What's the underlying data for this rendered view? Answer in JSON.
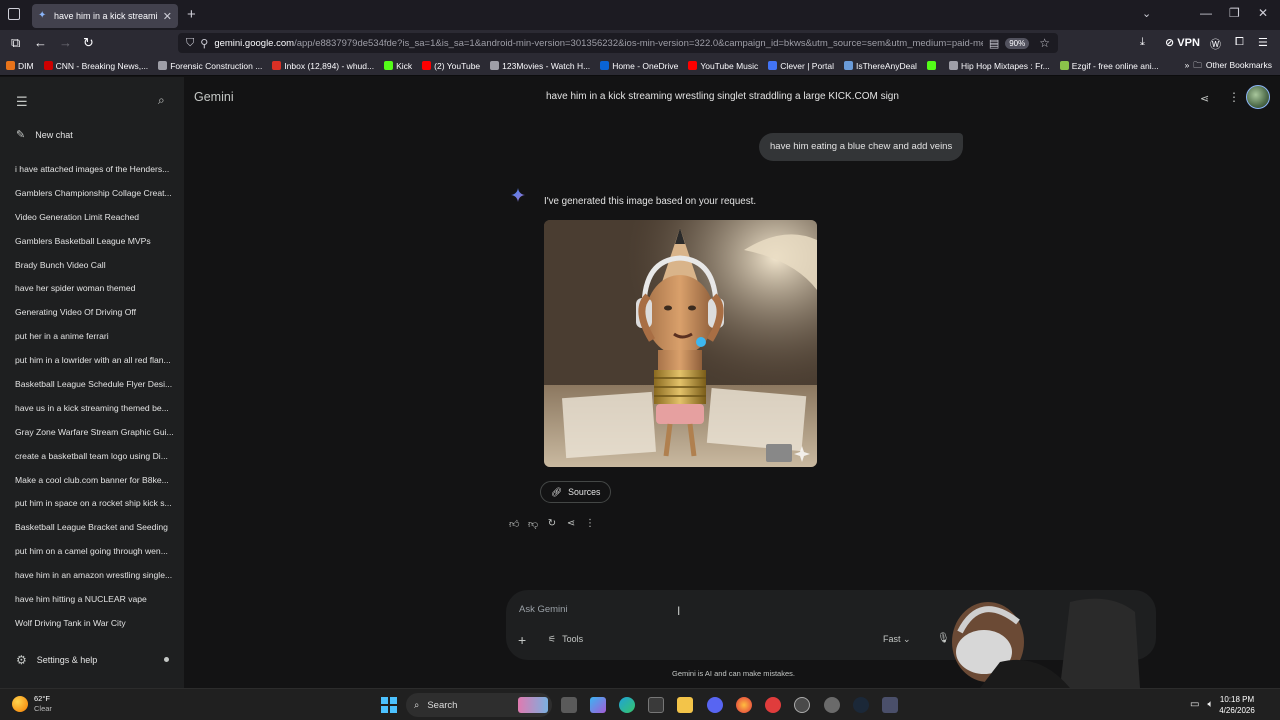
{
  "browser": {
    "tab_title": "have him in a kick streaming wr",
    "url_host": "gemini.google.com",
    "url_rest": "/app/e8837979de534fde?is_sa=1&is_sa=1&android-min-version=301356232&ios-min-version=322.0&campaign_id=bkws&utm_source=sem&utm_medium=paid-medi",
    "url_prefix": "",
    "zoom": "90%",
    "vpn_label": "VPN",
    "bookmarks": [
      {
        "label": "DIM",
        "color": "#e8731a"
      },
      {
        "label": "CNN - Breaking News,...",
        "color": "#cc0000"
      },
      {
        "label": "Forensic Construction ...",
        "color": "#9e9ea7"
      },
      {
        "label": "Inbox (12,894) - whud...",
        "color": "#d93025"
      },
      {
        "label": "Kick",
        "color": "#53fc18"
      },
      {
        "label": "(2) YouTube",
        "color": "#ff0000"
      },
      {
        "label": "123Movies - Watch H...",
        "color": "#9e9ea7"
      },
      {
        "label": "Home - OneDrive",
        "color": "#0a64d6"
      },
      {
        "label": "YouTube Music",
        "color": "#ff0000"
      },
      {
        "label": "Clever | Portal",
        "color": "#4274f6"
      },
      {
        "label": "IsThereAnyDeal",
        "color": "#6a9bd8"
      },
      {
        "label": "",
        "color": "#53fc18"
      },
      {
        "label": "Hip Hop Mixtapes : Fr...",
        "color": "#9e9ea7"
      },
      {
        "label": "Ezgif - free online ani...",
        "color": "#8bc34a"
      }
    ],
    "other_bookmarks": "Other Bookmarks"
  },
  "sidebar": {
    "new_chat": "New chat",
    "chats": [
      "i have attached images of the Henders...",
      "Gamblers Championship Collage Creat...",
      "Video Generation Limit Reached",
      "Gamblers Basketball League MVPs",
      "Brady Bunch Video Call",
      "have her spider woman themed",
      "Generating Video Of Driving Off",
      "put her in a anime ferrari",
      "put him in a lowrider with an all red flan...",
      "Basketball League Schedule Flyer Desi...",
      "have us in a kick streaming themed be...",
      "Gray Zone Warfare Stream Graphic Gui...",
      "create a basketball team logo using Di...",
      "Make a cool club.com banner for B8ke...",
      "put him in space on a rocket ship kick s...",
      "Basketball League Bracket and Seeding",
      "put him on a camel going through wen...",
      "have him in an amazon wrestling single...",
      "have him hitting a NUCLEAR vape",
      "Wolf Driving Tank in War City"
    ],
    "settings": "Settings & help"
  },
  "main": {
    "brand": "Gemini",
    "conversation_title": "have him in a kick streaming wrestling singlet straddling a large KICK.COM sign",
    "user_message": "have him eating a blue chew and add veins",
    "reply_text": "I've generated this image based on your request.",
    "sources": "Sources",
    "input_placeholder": "Ask Gemini",
    "tools": "Tools",
    "mode": "Fast",
    "disclaimer": "Gemini is AI and can make mistakes."
  },
  "taskbar": {
    "temp": "62°F",
    "condition": "Clear",
    "search": "Search",
    "time": "10:18 PM",
    "date": "4/26/2026"
  },
  "colors": {
    "background": "#131314",
    "sidebar": "#1e1f20",
    "accent": "#8ab4f8"
  }
}
